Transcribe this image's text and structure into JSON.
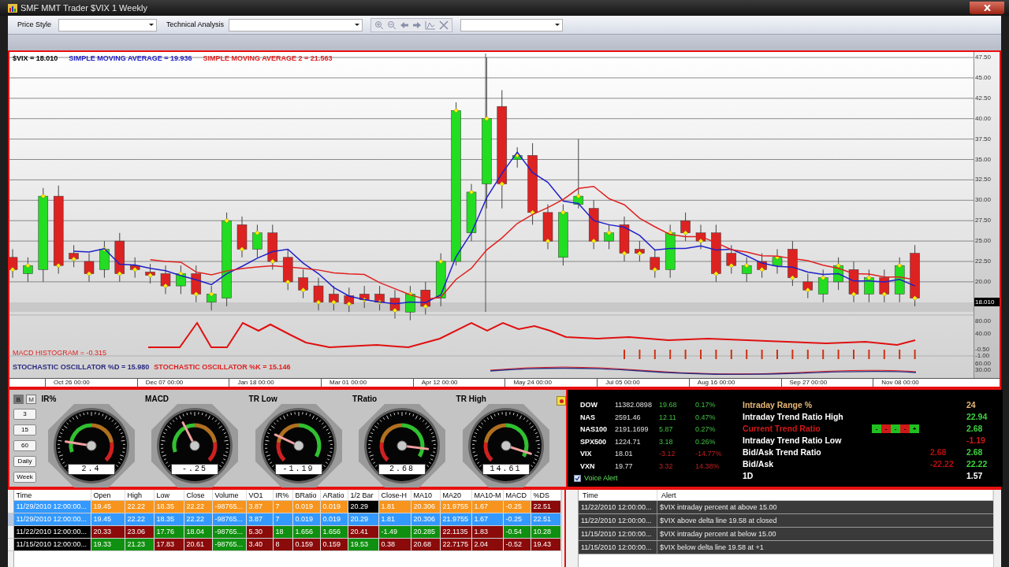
{
  "window": {
    "title": "SMF MMT Trader $VIX  1 Weekly"
  },
  "toolbar": {
    "price_style_label": "Price Style",
    "technical_analysis_label": "Technical Analysis"
  },
  "chart": {
    "legend": [
      {
        "text": "$VIX = 18.010",
        "color": "#000000"
      },
      {
        "text": "SIMPLE MOVING AVERAGE = 19.936",
        "color": "#2020c8"
      },
      {
        "text": "SIMPLE MOVING AVERAGE 2 = 21.563",
        "color": "#e02020"
      }
    ],
    "price_axis": [
      "47.50",
      "45.00",
      "42.50",
      "40.00",
      "37.50",
      "35.00",
      "32.50",
      "30.00",
      "27.50",
      "25.00",
      "22.50",
      "20.00"
    ],
    "last_price": "18.010",
    "indicator_axis": [
      "80.00",
      "40.00",
      "-0.50",
      "-1.00",
      "60.00",
      "30.00"
    ],
    "macd_label": "MACD HISTOGRAM = -0.315",
    "stoch_labels": [
      {
        "text": "STOCHASTIC OSCILLATOR %D = 15.980",
        "color": "#2a2a80"
      },
      {
        "text": "STOCHASTIC OSCILLATOR %K = 15.146",
        "color": "#e02020"
      }
    ],
    "dates": [
      "Oct 26 00:00",
      "Dec 07 00:00",
      "Jan 18 00:00",
      "Mar 01 00:00",
      "Apr 12 00:00",
      "May 24 00:00",
      "Jul 05 00:00",
      "Aug 16 00:00",
      "Sep 27 00:00",
      "Nov 08 00:00"
    ]
  },
  "periods": [
    {
      "label": "B",
      "selected": true
    },
    {
      "label": "M",
      "selected": false
    },
    {
      "label": "3",
      "selected": false
    },
    {
      "label": "15",
      "selected": false
    },
    {
      "label": "60",
      "selected": false
    },
    {
      "label": "Daily",
      "selected": false
    },
    {
      "label": "Week",
      "selected": false
    }
  ],
  "gauges": [
    {
      "label": "IR%",
      "kind": "rising",
      "value": "2.4"
    },
    {
      "label": "MACD",
      "kind": "rising",
      "value": "-.25"
    },
    {
      "label": "TR Low",
      "kind": "falling",
      "value": "-1.19"
    },
    {
      "label": "TRatio",
      "kind": "falling",
      "value": "2.68"
    },
    {
      "label": "TR High",
      "kind": "falling",
      "value": "14.61"
    }
  ],
  "quotes": [
    {
      "name": "DOW",
      "price": "11382.0898",
      "change": "19.68",
      "percent": "0.17%",
      "negative": false
    },
    {
      "name": "NAS",
      "price": "2591.46",
      "change": "12.11",
      "percent": "0.47%",
      "negative": false
    },
    {
      "name": "NAS100",
      "price": "2191.1699",
      "change": "5.87",
      "percent": "0.27%",
      "negative": false
    },
    {
      "name": "SPX500",
      "price": "1224.71",
      "change": "3.18",
      "percent": "0.26%",
      "negative": false
    },
    {
      "name": "VIX",
      "price": "18.01",
      "change": "-3.12",
      "percent": "-14.77%",
      "negative": true
    },
    {
      "name": "VXN",
      "price": "19.77",
      "change": "3.32",
      "percent": "14.38%",
      "negative": true
    }
  ],
  "voice_alert": {
    "label": "Voice Alert",
    "checked": true
  },
  "stats": [
    {
      "label": "Intraday Range %",
      "color": "#e8b878",
      "values": [
        {
          "text": "24",
          "color": "#e8b878"
        }
      ]
    },
    {
      "label": "Intraday Trend Ratio High",
      "color": "#ffffff",
      "values": [
        {
          "text": "22.94",
          "color": "#40d040"
        }
      ]
    },
    {
      "label": "Current Trend Ratio",
      "color": "#d01818",
      "trend_boxes": [
        {
          "text": "-",
          "color": "#20c020"
        },
        {
          "text": "-",
          "color": "#d01818"
        },
        {
          "text": "-",
          "color": "#20c020"
        },
        {
          "text": "-",
          "color": "#d01818"
        },
        {
          "text": "+",
          "color": "#20c020"
        }
      ],
      "values": [
        {
          "text": "2.68",
          "color": "#40d040"
        }
      ]
    },
    {
      "label": "Intraday Trend Ratio Low",
      "color": "#ffffff",
      "values": [
        {
          "text": "-1.19",
          "color": "#d01818"
        }
      ]
    },
    {
      "label": "Bid/Ask Trend Ratio",
      "color": "#ffffff",
      "values": [
        {
          "text": "2.68",
          "color": "#b01010"
        },
        {
          "text": "2.68",
          "color": "#40d040"
        }
      ]
    },
    {
      "label": "Bid/Ask",
      "color": "#ffffff",
      "values": [
        {
          "text": "-22.22",
          "color": "#b01010"
        },
        {
          "text": "22.22",
          "color": "#40d040"
        }
      ]
    },
    {
      "label": "1D",
      "color": "#ffffff",
      "values": [
        {
          "text": "1.57",
          "color": "#ffffff"
        }
      ]
    }
  ],
  "bars_table": {
    "columns": [
      "Time",
      "Open",
      "High",
      "Low",
      "Close",
      "Volume",
      "VO1",
      "IR%",
      "BRatio",
      "ARatio",
      "1/2 Bar",
      "Close-H",
      "MA10",
      "MA20",
      "MA10-M",
      "MACD",
      "%DS"
    ],
    "rows": [
      {
        "selected": false,
        "cells": [
          {
            "text": "11/29/2010 12:00:00...",
            "color": "#3399ff"
          },
          {
            "text": "19.45",
            "color": "#f7941d"
          },
          {
            "text": "22.22",
            "color": "#f7941d"
          },
          {
            "text": "18.35",
            "color": "#f7941d"
          },
          {
            "text": "22.22",
            "color": "#f7941d"
          },
          {
            "text": "-98765...",
            "color": "#f7941d"
          },
          {
            "text": "3.87",
            "color": "#f7941d"
          },
          {
            "text": "7",
            "color": "#f7941d"
          },
          {
            "text": "0.019",
            "color": "#f7941d"
          },
          {
            "text": "0.019",
            "color": "#f7941d"
          },
          {
            "text": "20.29",
            "color": "#000000"
          },
          {
            "text": "1.81",
            "color": "#f7941d"
          },
          {
            "text": "20.306",
            "color": "#f7941d"
          },
          {
            "text": "21.9755",
            "color": "#f7941d"
          },
          {
            "text": "1.67",
            "color": "#f7941d"
          },
          {
            "text": "-0.25",
            "color": "#f7941d"
          },
          {
            "text": "22.51",
            "color": "#8b0a0a"
          }
        ]
      },
      {
        "selected": true,
        "cells": [
          {
            "text": "11/29/2010 12:00:00...",
            "color": "#3399ff"
          },
          {
            "text": "19.45",
            "color": "#3399ff"
          },
          {
            "text": "22.22",
            "color": "#3399ff"
          },
          {
            "text": "18.35",
            "color": "#3399ff"
          },
          {
            "text": "22.22",
            "color": "#3399ff"
          },
          {
            "text": "-98765...",
            "color": "#3399ff"
          },
          {
            "text": "3.87",
            "color": "#3399ff"
          },
          {
            "text": "7",
            "color": "#3399ff"
          },
          {
            "text": "0.019",
            "color": "#3399ff"
          },
          {
            "text": "0.019",
            "color": "#3399ff"
          },
          {
            "text": "20.29",
            "color": "#3399ff"
          },
          {
            "text": "1.81",
            "color": "#3399ff"
          },
          {
            "text": "20.306",
            "color": "#3399ff"
          },
          {
            "text": "21.9755",
            "color": "#3399ff"
          },
          {
            "text": "1.67",
            "color": "#3399ff"
          },
          {
            "text": "-0.25",
            "color": "#3399ff"
          },
          {
            "text": "22.51",
            "color": "#3399ff"
          }
        ]
      },
      {
        "selected": false,
        "cells": [
          {
            "text": "11/22/2010 12:00:00...",
            "color": "#000000"
          },
          {
            "text": "20.33",
            "color": "#8b0a0a"
          },
          {
            "text": "23.06",
            "color": "#8b0a0a"
          },
          {
            "text": "17.76",
            "color": "#109010"
          },
          {
            "text": "18.04",
            "color": "#109010"
          },
          {
            "text": "-98765...",
            "color": "#109010"
          },
          {
            "text": "5.30",
            "color": "#8b0a0a"
          },
          {
            "text": "18",
            "color": "#109010"
          },
          {
            "text": "1.656",
            "color": "#109010"
          },
          {
            "text": "1.656",
            "color": "#109010"
          },
          {
            "text": "20.41",
            "color": "#8b0a0a"
          },
          {
            "text": "-1.49",
            "color": "#109010"
          },
          {
            "text": "20.285",
            "color": "#109010"
          },
          {
            "text": "22.1135",
            "color": "#8b0a0a"
          },
          {
            "text": "1.83",
            "color": "#8b0a0a"
          },
          {
            "text": "-0.54",
            "color": "#109010"
          },
          {
            "text": "10.28",
            "color": "#109010"
          }
        ]
      },
      {
        "selected": false,
        "cells": [
          {
            "text": "11/15/2010 12:00:00...",
            "color": "#000000"
          },
          {
            "text": "19.33",
            "color": "#109010"
          },
          {
            "text": "21.23",
            "color": "#109010"
          },
          {
            "text": "17.83",
            "color": "#8b0a0a"
          },
          {
            "text": "20.61",
            "color": "#8b0a0a"
          },
          {
            "text": "-98765...",
            "color": "#109010"
          },
          {
            "text": "3.40",
            "color": "#8b0a0a"
          },
          {
            "text": "8",
            "color": "#8b0a0a"
          },
          {
            "text": "0.159",
            "color": "#8b0a0a"
          },
          {
            "text": "0.159",
            "color": "#8b0a0a"
          },
          {
            "text": "19.53",
            "color": "#109010"
          },
          {
            "text": "0.38",
            "color": "#8b0a0a"
          },
          {
            "text": "20.68",
            "color": "#8b0a0a"
          },
          {
            "text": "22.7175",
            "color": "#8b0a0a"
          },
          {
            "text": "2.04",
            "color": "#8b0a0a"
          },
          {
            "text": "-0.52",
            "color": "#8b0a0a"
          },
          {
            "text": "19.43",
            "color": "#8b0a0a"
          }
        ]
      }
    ]
  },
  "alerts_table": {
    "columns": [
      "Time",
      "Alert"
    ],
    "rows": [
      {
        "time": "11/22/2010 12:00:00...",
        "alert": "$VIX intraday percent at above 15.00"
      },
      {
        "time": "11/22/2010 12:00:00...",
        "alert": "$VIX above delta line 19.58 at closed"
      },
      {
        "time": "11/15/2010 12:00:00...",
        "alert": "$VIX intraday percent at below 15.00"
      },
      {
        "time": "11/15/2010 12:00:00...",
        "alert": "$VIX below delta line 19.58 at +1"
      }
    ]
  }
}
